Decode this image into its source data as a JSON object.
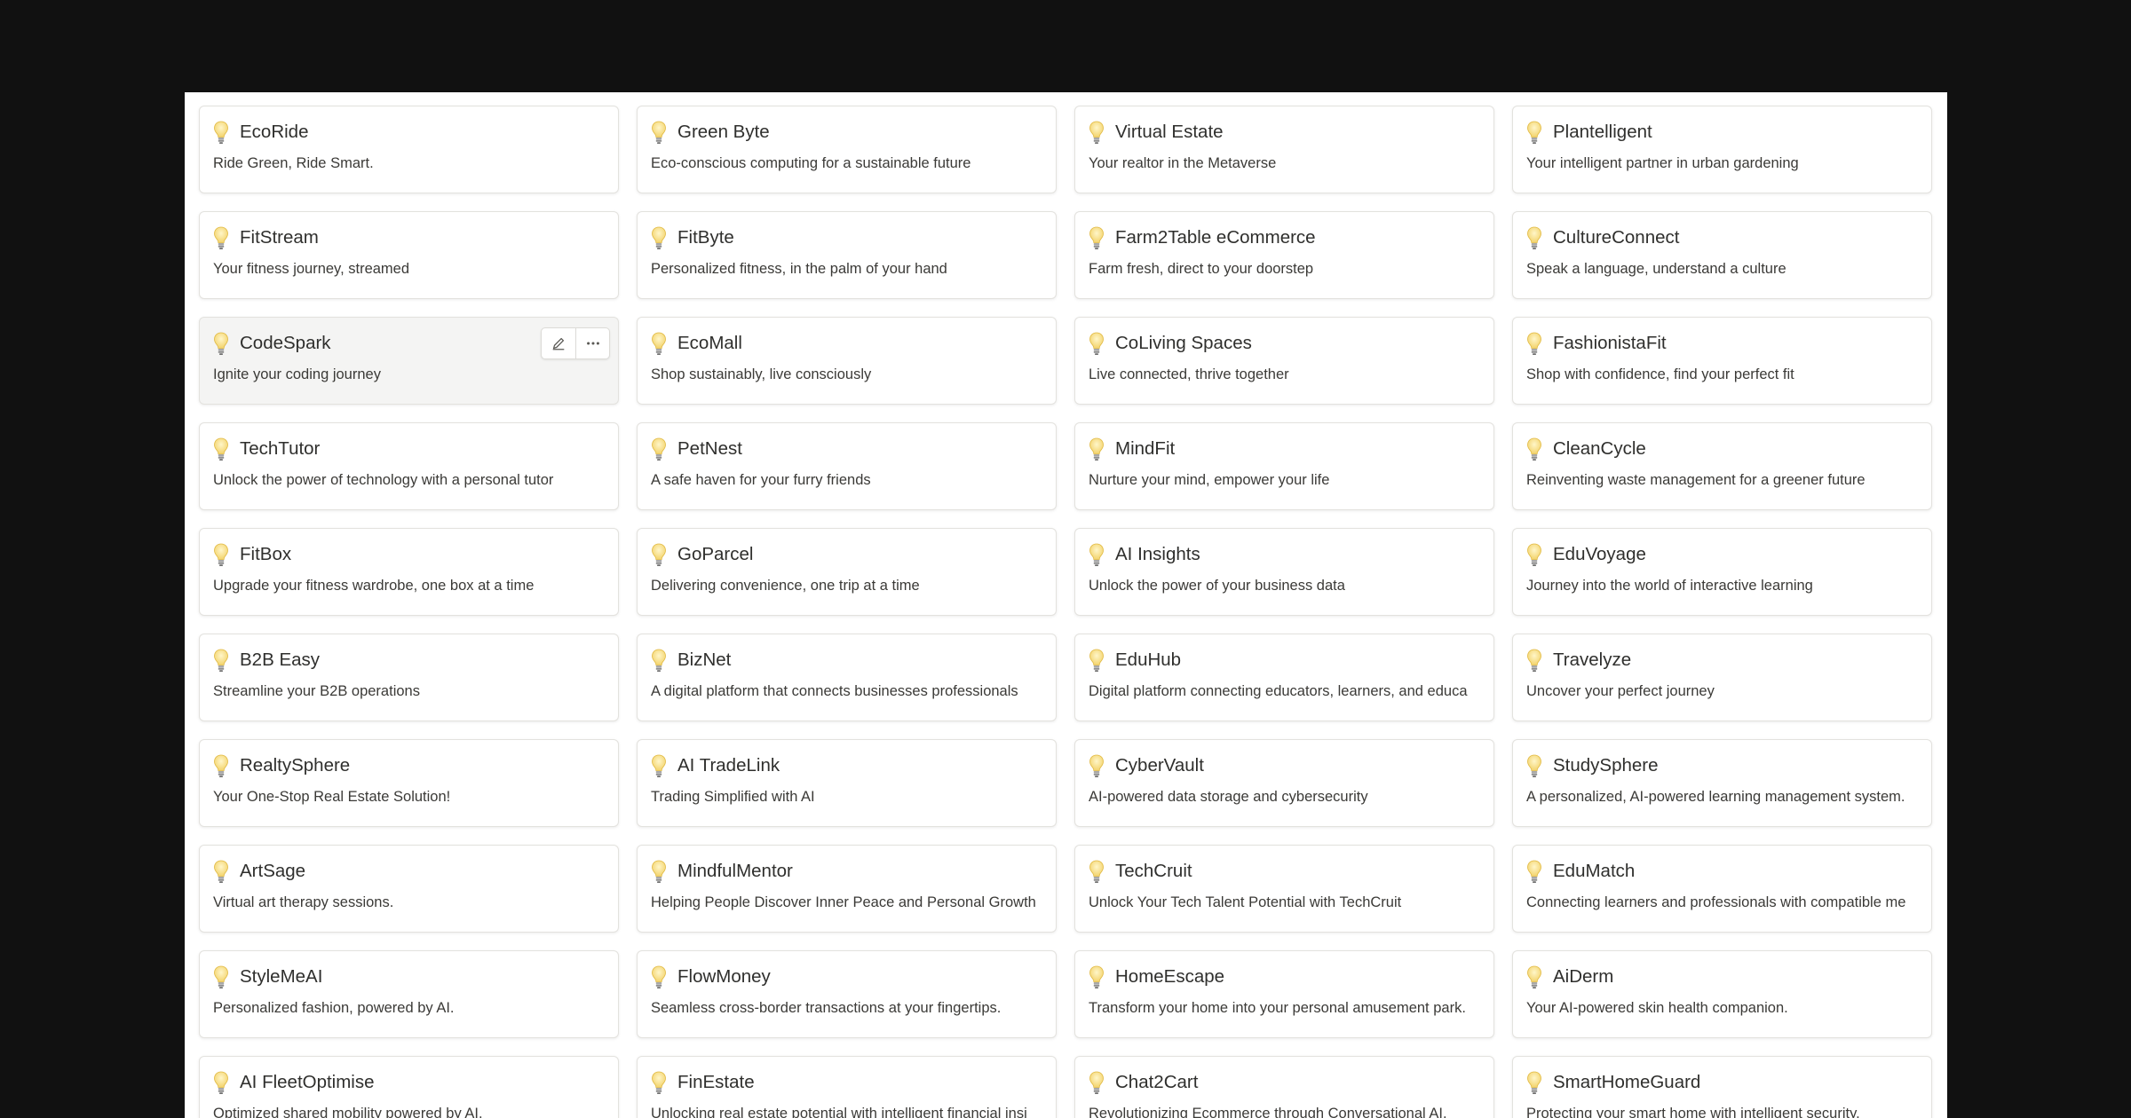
{
  "card_icon": "lightbulb-icon",
  "card_actions": {
    "edit_icon": "pencil-icon",
    "more_icon": "more-horizontal-icon"
  },
  "cards": [
    {
      "title": "EcoRide",
      "desc": "Ride Green, Ride Smart."
    },
    {
      "title": "Green Byte",
      "desc": "Eco-conscious computing for a sustainable future"
    },
    {
      "title": "Virtual Estate",
      "desc": "Your realtor in the Metaverse"
    },
    {
      "title": "Plantelligent",
      "desc": "Your intelligent partner in urban gardening"
    },
    {
      "title": "FitStream",
      "desc": "Your fitness journey, streamed"
    },
    {
      "title": "FitByte",
      "desc": "Personalized fitness, in the palm of your hand"
    },
    {
      "title": "Farm2Table eCommerce",
      "desc": "Farm fresh, direct to your doorstep"
    },
    {
      "title": "CultureConnect",
      "desc": "Speak a language, understand a culture"
    },
    {
      "title": "CodeSpark",
      "desc": "Ignite your coding journey",
      "hovered": true
    },
    {
      "title": "EcoMall",
      "desc": "Shop sustainably, live consciously"
    },
    {
      "title": "CoLiving Spaces",
      "desc": "Live connected, thrive together"
    },
    {
      "title": "FashionistaFit",
      "desc": "Shop with confidence, find your perfect fit"
    },
    {
      "title": "TechTutor",
      "desc": "Unlock the power of technology with a personal tutor"
    },
    {
      "title": "PetNest",
      "desc": "A safe haven for your furry friends"
    },
    {
      "title": "MindFit",
      "desc": "Nurture your mind, empower your life"
    },
    {
      "title": "CleanCycle",
      "desc": "Reinventing waste management for a greener future"
    },
    {
      "title": "FitBox",
      "desc": "Upgrade your fitness wardrobe, one box at a time"
    },
    {
      "title": "GoParcel",
      "desc": "Delivering convenience, one trip at a time"
    },
    {
      "title": "AI Insights",
      "desc": "Unlock the power of your business data"
    },
    {
      "title": "EduVoyage",
      "desc": "Journey into the world of interactive learning"
    },
    {
      "title": "B2B Easy",
      "desc": "Streamline your B2B operations"
    },
    {
      "title": "BizNet",
      "desc": "A digital platform that connects businesses professionals"
    },
    {
      "title": "EduHub",
      "desc": "Digital platform connecting educators, learners, and educa"
    },
    {
      "title": "Travelyze",
      "desc": "Uncover your perfect journey"
    },
    {
      "title": "RealtySphere",
      "desc": "Your One-Stop Real Estate Solution!"
    },
    {
      "title": "AI TradeLink",
      "desc": "Trading Simplified with AI"
    },
    {
      "title": "CyberVault",
      "desc": "AI-powered data storage and cybersecurity"
    },
    {
      "title": "StudySphere",
      "desc": "A personalized, AI-powered learning management system."
    },
    {
      "title": "ArtSage",
      "desc": "Virtual art therapy sessions."
    },
    {
      "title": "MindfulMentor",
      "desc": "Helping People Discover Inner Peace and Personal Growth"
    },
    {
      "title": "TechCruit",
      "desc": "Unlock Your Tech Talent Potential with TechCruit"
    },
    {
      "title": "EduMatch",
      "desc": "Connecting learners and professionals with compatible me"
    },
    {
      "title": "StyleMeAI",
      "desc": "Personalized fashion, powered by AI."
    },
    {
      "title": "FlowMoney",
      "desc": "Seamless cross-border transactions at your fingertips."
    },
    {
      "title": "HomeEscape",
      "desc": "Transform your home into your personal amusement park."
    },
    {
      "title": "AiDerm",
      "desc": "Your AI-powered skin health companion."
    },
    {
      "title": "AI FleetOptimise",
      "desc": "Optimized shared mobility powered by AI."
    },
    {
      "title": "FinEstate",
      "desc": "Unlocking real estate potential with intelligent financial insi"
    },
    {
      "title": "Chat2Cart",
      "desc": "Revolutionizing Ecommerce through Conversational AI."
    },
    {
      "title": "SmartHomeGuard",
      "desc": "Protecting your smart home with intelligent security."
    }
  ]
}
